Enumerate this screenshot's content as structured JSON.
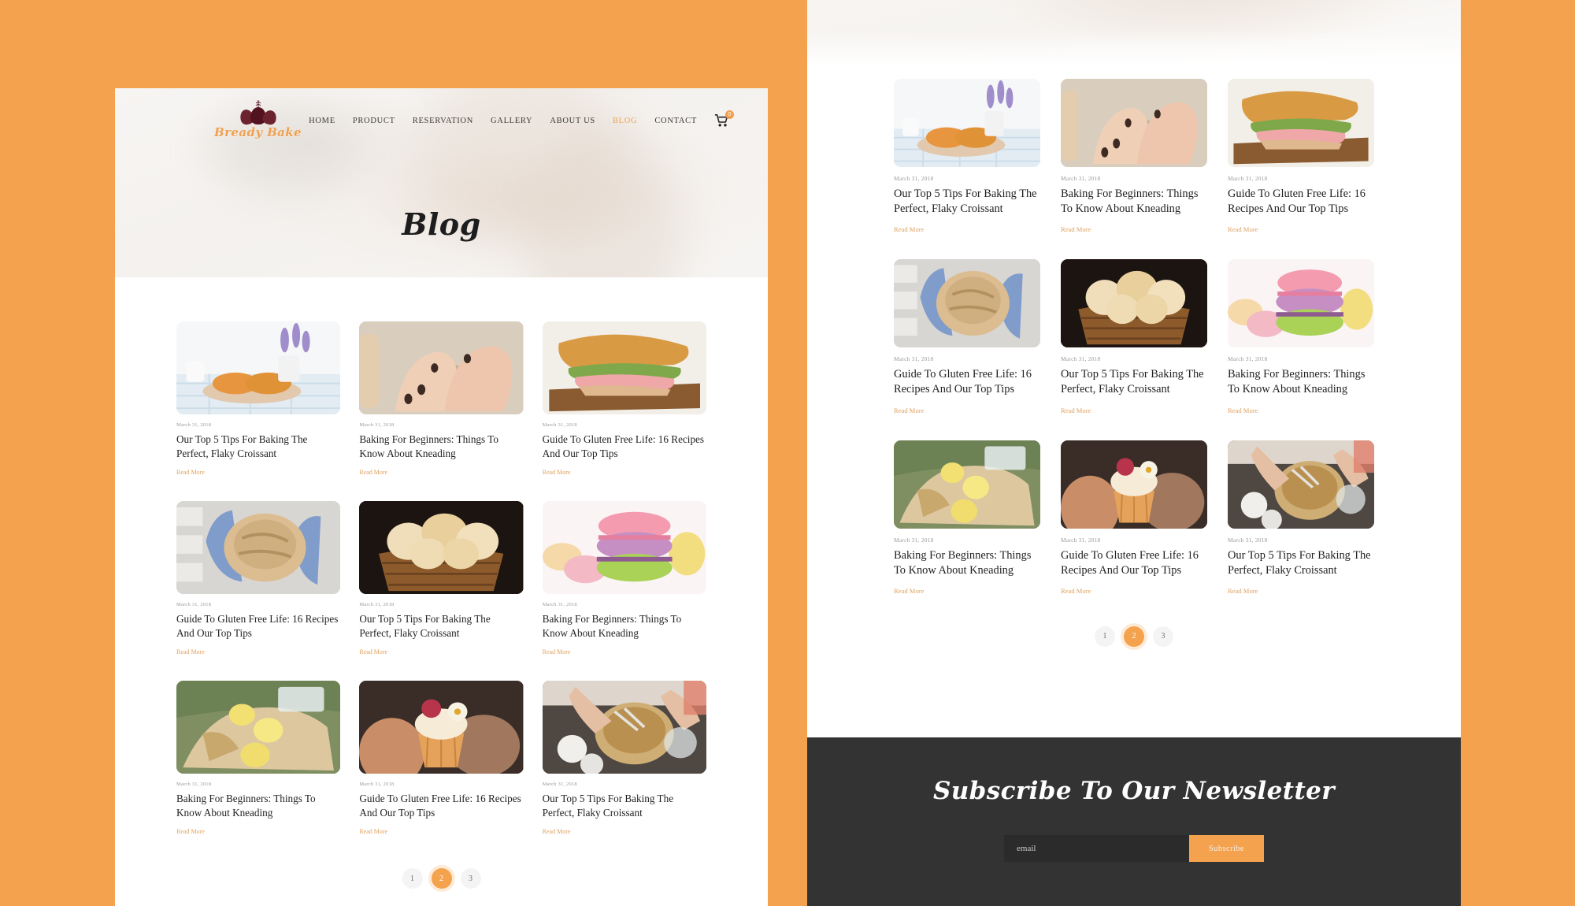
{
  "theme": {
    "background": "#f5a24e",
    "accent": "#f5a24e",
    "link": "#e0a260",
    "text": "#1f1f1f",
    "muted": "#9a9a9a",
    "footer_bg": "#333333"
  },
  "header": {
    "brand_name": "Bready Bake",
    "nav": [
      {
        "label": "HOME",
        "active": false
      },
      {
        "label": "PRODUCT",
        "active": false
      },
      {
        "label": "RESERVATION",
        "active": false
      },
      {
        "label": "GALLERY",
        "active": false
      },
      {
        "label": "ABOUT US",
        "active": false
      },
      {
        "label": "BLOG",
        "active": true
      },
      {
        "label": "CONTACT",
        "active": false
      }
    ],
    "cart_count": "0"
  },
  "hero": {
    "title": "Blog"
  },
  "posts": [
    {
      "date": "March 31, 2018",
      "title": "Our Top 5 Tips For Baking The Perfect, Flaky Croissant",
      "link": "Read More",
      "image": "croissants-on-plate"
    },
    {
      "date": "March 31, 2018",
      "title": "Baking For Beginners: Things To Know About Kneading",
      "link": "Read More",
      "image": "hands-kneading-dough"
    },
    {
      "date": "March 31, 2018",
      "title": "Guide To Gluten Free Life: 16 Recipes And Our Top Tips",
      "link": "Read More",
      "image": "croissant-sandwich"
    },
    {
      "date": "March 31, 2018",
      "title": "Guide To Gluten Free Life: 16 Recipes And Our Top Tips",
      "link": "Read More",
      "image": "bread-loaf-in-cloth"
    },
    {
      "date": "March 31, 2018",
      "title": "Our Top 5 Tips For Baking The Perfect, Flaky Croissant",
      "link": "Read More",
      "image": "basket-of-rolls"
    },
    {
      "date": "March 31, 2018",
      "title": "Baking For Beginners: Things To Know About Kneading",
      "link": "Read More",
      "image": "stacked-macarons"
    },
    {
      "date": "March 31, 2018",
      "title": "Baking For Beginners: Things To Know About Kneading",
      "link": "Read More",
      "image": "picnic-lemonade"
    },
    {
      "date": "March 31, 2018",
      "title": "Guide To Gluten Free Life: 16 Recipes And Our Top Tips",
      "link": "Read More",
      "image": "cupcake-in-hand"
    },
    {
      "date": "March 31, 2018",
      "title": "Our Top 5 Tips For Baking The Perfect, Flaky Croissant",
      "link": "Read More",
      "image": "mixing-batter-bowl"
    }
  ],
  "pagination": [
    {
      "label": "1",
      "active": false
    },
    {
      "label": "2",
      "active": true
    },
    {
      "label": "3",
      "active": false
    }
  ],
  "newsletter": {
    "title": "Subscribe To Our Newsletter",
    "email_placeholder": "email",
    "email_value": "",
    "submit_label": "Subscribe"
  }
}
